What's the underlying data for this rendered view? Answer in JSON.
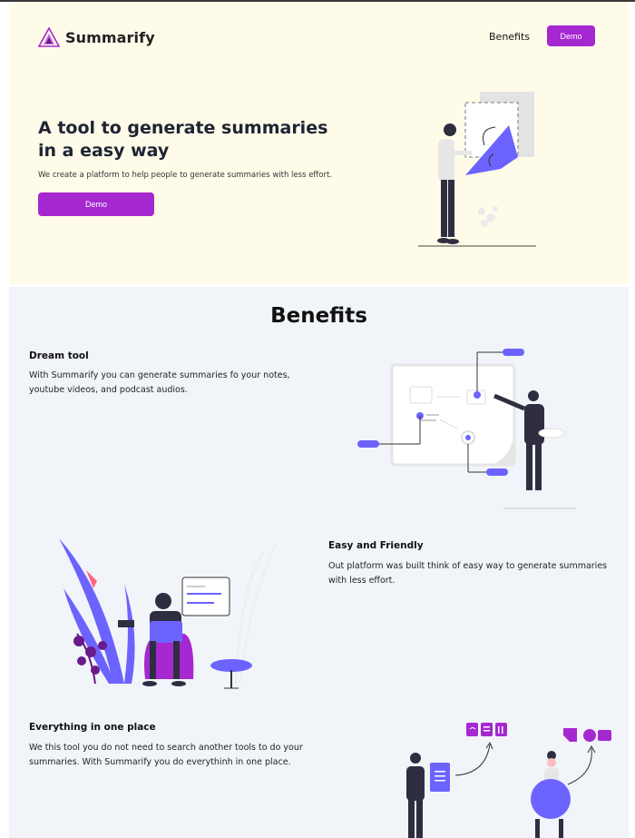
{
  "header": {
    "brand": "Summarify",
    "nav_benefits": "Benefits",
    "nav_demo": "Demo"
  },
  "hero": {
    "title": "A tool to generate summaries in a easy way",
    "subtitle": "We create a platform to help people to generate summaries with less effort.",
    "cta": "Demo"
  },
  "benefits": {
    "title": "Benefits",
    "items": [
      {
        "title": "Dream tool",
        "text": "With Summarify you can generate summaries fo your notes, youtube videos, and podcast audios."
      },
      {
        "title": "Easy and Friendly",
        "text": "Out platform was built think of easy way to generate summaries with less effort."
      },
      {
        "title": "Everything in one place",
        "text": "We this tool you do not need to search another tools to do your summaries. With Summarify you do everythinh in one place."
      }
    ]
  },
  "colors": {
    "accent": "#a528d0",
    "illustration": "#6c63ff",
    "hero_bg": "#fffbe9",
    "benefits_bg": "#f1f4f9"
  },
  "icons": [
    "logo-triangle-icon"
  ]
}
